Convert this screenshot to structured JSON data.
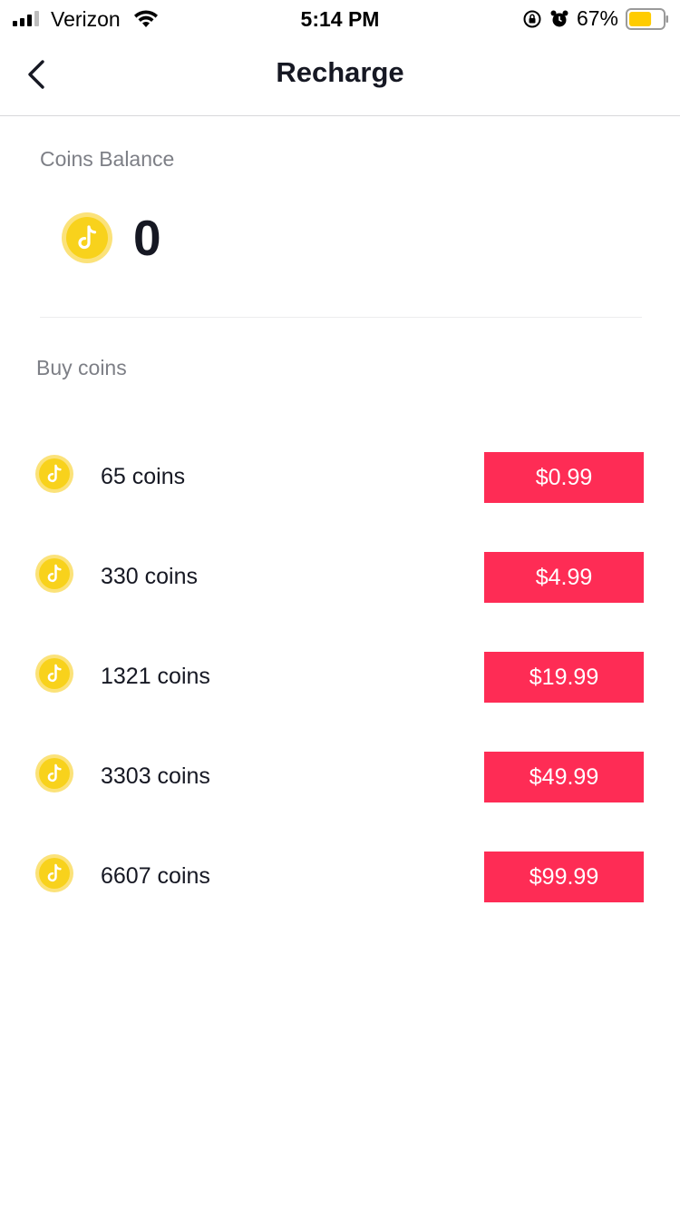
{
  "status_bar": {
    "carrier": "Verizon",
    "time": "5:14 PM",
    "battery_percent": "67%",
    "battery_level": 0.67,
    "icons": [
      "signal-icon",
      "wifi-icon",
      "rotation-lock-icon",
      "alarm-icon",
      "battery-icon"
    ]
  },
  "nav": {
    "title": "Recharge",
    "back_icon": "chevron-left-icon"
  },
  "balance": {
    "label": "Coins Balance",
    "value": "0",
    "icon": "coin-icon"
  },
  "buy": {
    "label": "Buy coins",
    "packages": [
      {
        "amount": "65 coins",
        "price": "$0.99"
      },
      {
        "amount": "330 coins",
        "price": "$4.99"
      },
      {
        "amount": "1321 coins",
        "price": "$19.99"
      },
      {
        "amount": "3303 coins",
        "price": "$49.99"
      },
      {
        "amount": "6607 coins",
        "price": "$99.99"
      }
    ]
  },
  "colors": {
    "accent": "#fe2c55",
    "coin": "#f8d21c",
    "text": "#161823",
    "muted": "#7d7f86",
    "battery": "#ffcc00"
  }
}
